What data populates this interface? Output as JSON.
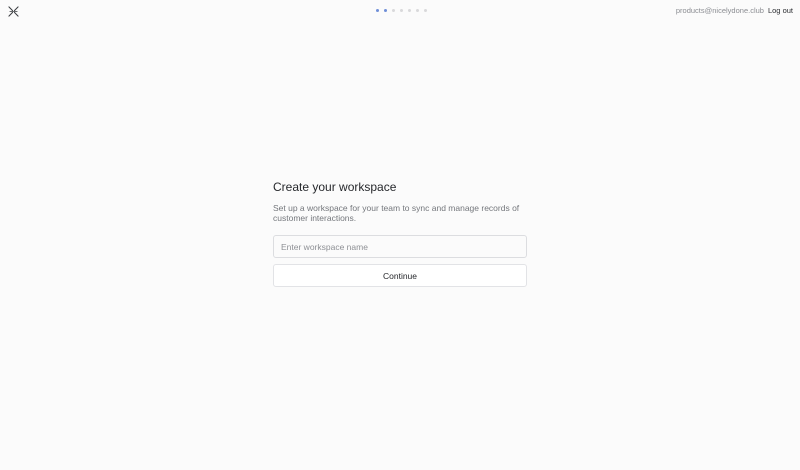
{
  "header": {
    "logo_icon": "close-x-logo-icon",
    "progress": {
      "total_steps": 7,
      "current_step": 2
    },
    "account": {
      "email": "products@nicelydone.club",
      "logout_label": "Log out"
    }
  },
  "main": {
    "title": "Create your workspace",
    "subtitle": "Set up a workspace for your team to sync and manage records of customer interactions.",
    "workspace_input": {
      "value": "",
      "placeholder": "Enter workspace name"
    },
    "continue_label": "Continue"
  },
  "colors": {
    "background": "#fbfbfb",
    "progress_active": "#6f8fd8",
    "progress_inactive": "#d9d9db",
    "text_primary": "#26282c",
    "text_secondary": "#74777c"
  }
}
